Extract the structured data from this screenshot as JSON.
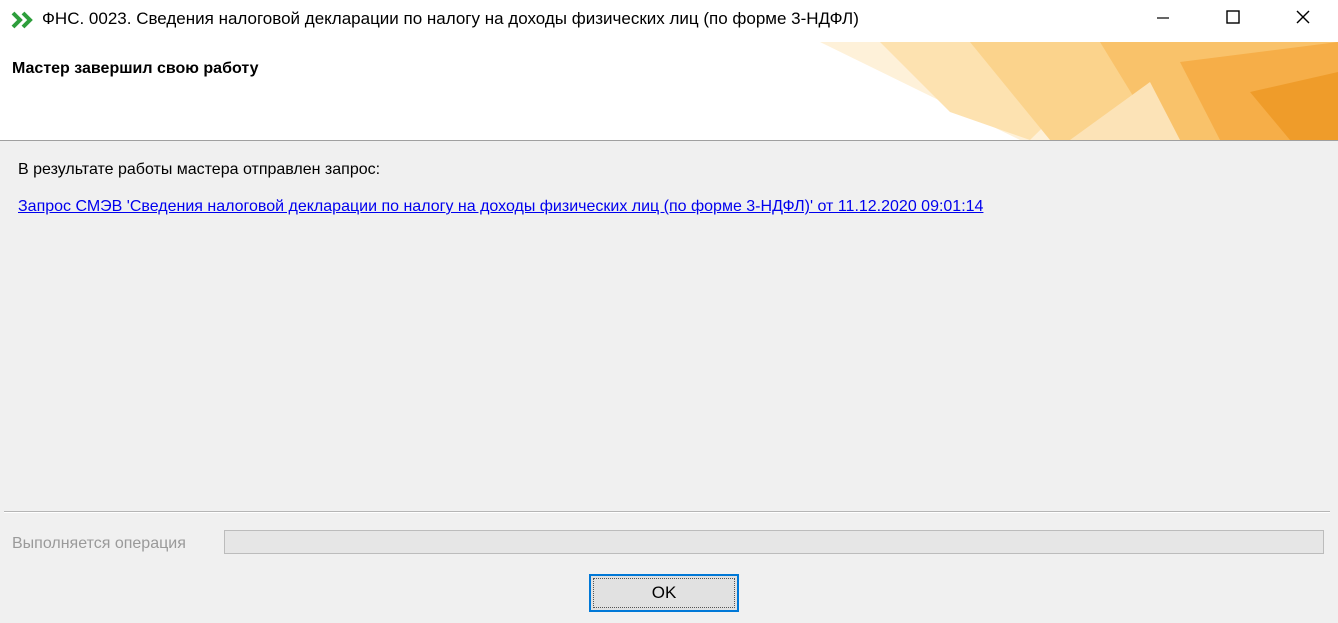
{
  "window": {
    "title": "ФНС. 0023. Сведения налоговой декларации по налогу на доходы физических лиц (по форме 3-НДФЛ)",
    "icon": "double-chevron-right-icon",
    "controls": [
      "minimize-icon",
      "maximize-icon",
      "close-icon"
    ]
  },
  "header": {
    "title": "Мастер завершил свою работу"
  },
  "content": {
    "result_text": "В результате работы мастера отправлен запрос:",
    "request_link": "Запрос СМЭВ 'Сведения налоговой декларации по налогу на доходы физических лиц (по форме 3-НДФЛ)' от 11.12.2020 09:01:14"
  },
  "footer": {
    "operation_label": "Выполняется операция",
    "progress_fraction": 0,
    "ok_label": "OK"
  },
  "colors": {
    "accent": "#0078d7",
    "link": "#0000ee",
    "header_decor_light": "#fde2b0",
    "header_decor_mid": "#f9c26a",
    "header_decor_dark": "#ef9c2a",
    "app_icon": "#2e9e3c"
  }
}
